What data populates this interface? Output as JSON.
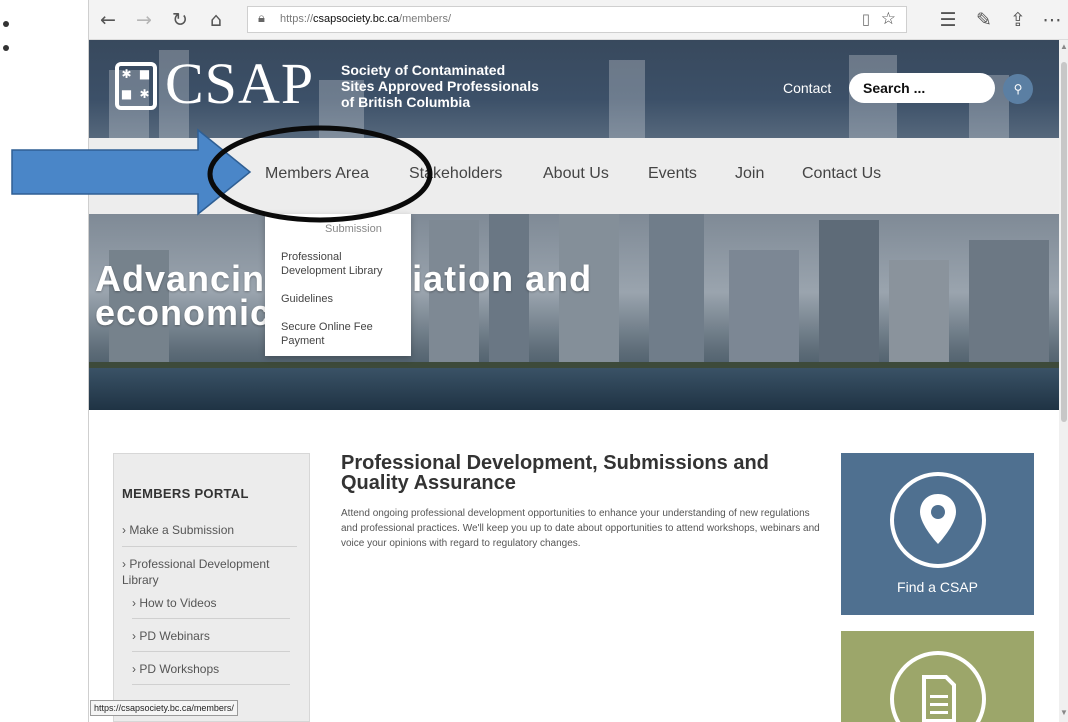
{
  "browser": {
    "url_prefix": "https://",
    "url_domain": "csapsociety.bc.ca",
    "url_path": "/members/",
    "status_url": "https://csapsociety.bc.ca/members/"
  },
  "header": {
    "logo_text": "CSAP",
    "tagline_1": "Society of Contaminated",
    "tagline_2": "Sites Approved Professionals",
    "tagline_3": "of British Columbia",
    "contact": "Contact",
    "search_value": "Search ..."
  },
  "nav": {
    "items": [
      "Members Area",
      "Stakeholders",
      "About Us",
      "Events",
      "Join",
      "Contact Us"
    ]
  },
  "dropdown": {
    "items": [
      "Submission",
      "Professional Development Library",
      "Guidelines",
      "Secure Online Fee Payment"
    ]
  },
  "hero": {
    "line1": "Advancing remediation and",
    "line2": "economic growth"
  },
  "portal": {
    "title": "MEMBERS PORTAL",
    "links": [
      "Make a Submission",
      "Professional Development Library",
      "How to Videos",
      "PD Webinars",
      "PD Workshops"
    ]
  },
  "main": {
    "heading": "Professional Development, Submissions and Quality Assurance",
    "body": "Attend ongoing professional development opportunities to enhance your understanding of new regulations and professional practices. We'll keep you up to date about opportunities to attend workshops, webinars and voice your opinions with regard to regulatory changes."
  },
  "cards": {
    "find": "Find a CSAP"
  },
  "colors": {
    "header": "#3c5068",
    "search_button": "#5b7fa3",
    "find_card": "#4f7090",
    "doc_card": "#9ca66a",
    "annotation_arrow": "#4a86c8"
  },
  "icons": [
    "back-icon",
    "forward-icon",
    "refresh-icon",
    "home-icon",
    "lock-icon",
    "reader-view-icon",
    "favorite-star-icon",
    "favorites-icon",
    "sign-icon",
    "share-icon",
    "more-icon",
    "search-icon",
    "location-pin-icon",
    "document-icon"
  ]
}
